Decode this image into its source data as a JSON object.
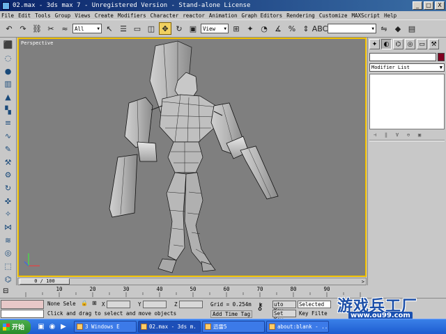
{
  "window": {
    "title": "02.max - 3ds max 7  - Unregistered Version - Stand-alone License",
    "minimize": "_",
    "maximize": "□",
    "close": "X"
  },
  "menu": [
    "File",
    "Edit",
    "Tools",
    "Group",
    "Views",
    "Create",
    "Modifiers",
    "Character",
    "reactor",
    "Animation",
    "Graph Editors",
    "Rendering",
    "Customize",
    "MAXScript",
    "Help"
  ],
  "toolbar": {
    "selection_filter": "All",
    "ref_coord": "View"
  },
  "viewport": {
    "label": "Perspective",
    "bg_color": "#7f7f7f",
    "border_color": "#f0c000"
  },
  "command_panel": {
    "modifier_list": "Modifier List",
    "object_color": "#800020"
  },
  "timeline": {
    "frame": "0 / 100",
    "ticks": [
      "10",
      "20",
      "30",
      "40",
      "50",
      "60",
      "70",
      "80",
      "90"
    ]
  },
  "status": {
    "selection": "None Sele",
    "x_label": "X",
    "y_label": "Y",
    "z_label": "Z",
    "grid": "Grid = 0.254m",
    "prompt": "Click and drag to select and move objects",
    "add_time_tag": "Add Time Tag",
    "auto_key": "uto Key",
    "set_key": "Set Key",
    "key_mode": "Selected",
    "key_filters": "Key Filte"
  },
  "watermark": {
    "title": "游戏兵工厂",
    "url": "www.ou99.com"
  },
  "taskbar": {
    "start": "开始",
    "tasks": [
      {
        "label": "3 Windows E",
        "active": false
      },
      {
        "label": "02.max - 3ds m.",
        "active": true
      },
      {
        "label": "迅雷5",
        "active": false
      },
      {
        "label": "about:blank - ...",
        "active": false
      }
    ]
  }
}
